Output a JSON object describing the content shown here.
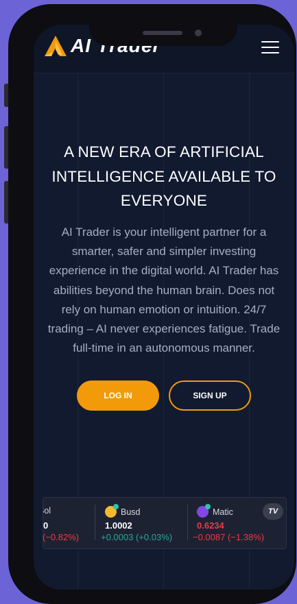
{
  "brand": {
    "name": "AI Trader"
  },
  "hero": {
    "headline_lines": [
      "A NEW ERA OF ARTIFICIAL",
      "INTELLIGENCE AVAILABLE TO",
      "EVERYONE"
    ],
    "description": "AI Trader is your intelligent partner for a smarter, safer and simpler investing experience in the digital world. AI Trader has abilities beyond the human brain. Does not rely on human emotion or intuition. 24/7 trading – AI never experiences fatigue. Trade full-time in an autonomous manner."
  },
  "actions": {
    "login_label": "LOG IN",
    "signup_label": "SIGN UP"
  },
  "ticker": {
    "items": [
      {
        "name": "Sol",
        "price": "0",
        "change": "(−0.82%)",
        "direction": "down"
      },
      {
        "name": "Busd",
        "price": "1.0002",
        "change": "+0.0003 (+0.03%)",
        "direction": "up"
      },
      {
        "name": "Matic",
        "price": "0.6234",
        "change": "−0.0087 (−1.38%)",
        "direction": "down"
      }
    ],
    "badge": "TV"
  },
  "colors": {
    "accent": "#f39a0b",
    "background": "#121a30",
    "up": "#22ab94",
    "down": "#f23645"
  }
}
